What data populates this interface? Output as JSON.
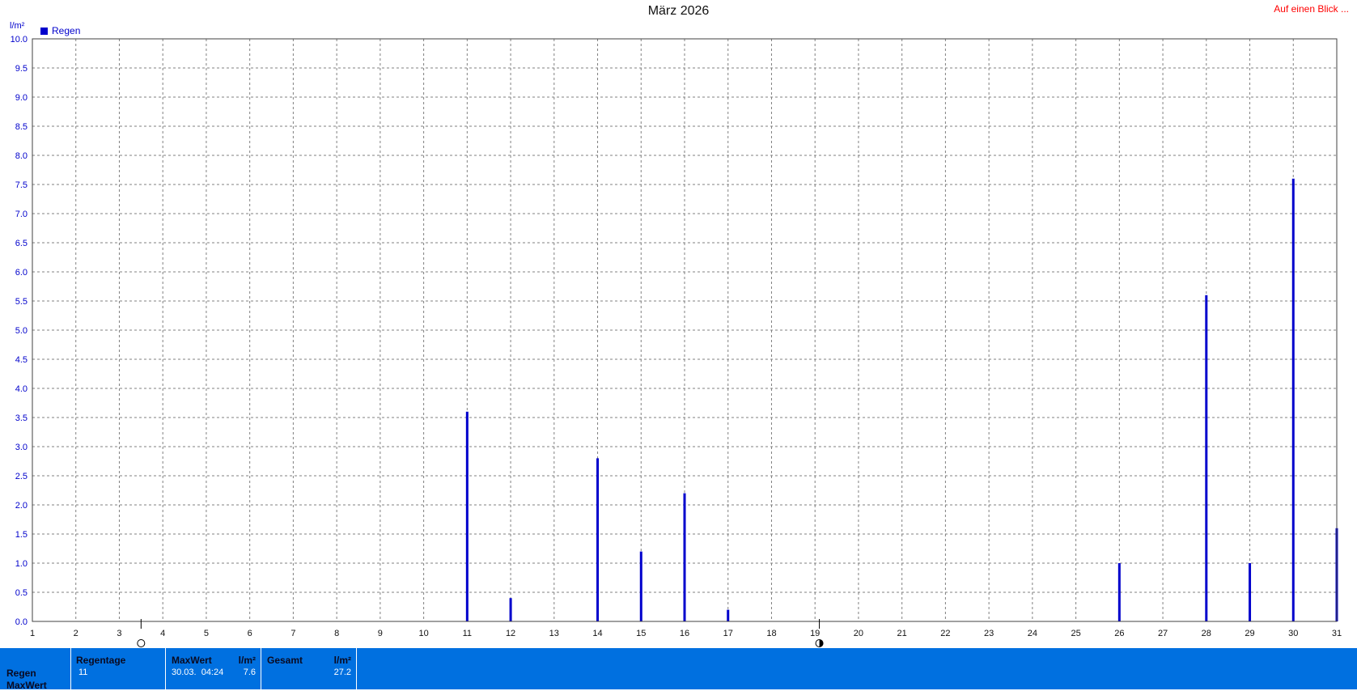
{
  "chart_data": {
    "type": "bar",
    "title": "März 2026",
    "ylabel": "l/m²",
    "ylim": [
      0,
      10
    ],
    "yticks": [
      "0.0",
      "0.5",
      "1.0",
      "1.5",
      "2.0",
      "2.5",
      "3.0",
      "3.5",
      "4.0",
      "4.5",
      "5.0",
      "5.5",
      "6.0",
      "6.5",
      "7.0",
      "7.5",
      "8.0",
      "8.5",
      "9.0",
      "9.5",
      "10.0"
    ],
    "xlim": [
      1,
      31
    ],
    "xticks": [
      "1",
      "2",
      "3",
      "4",
      "5",
      "6",
      "7",
      "8",
      "9",
      "10",
      "11",
      "12",
      "13",
      "14",
      "15",
      "16",
      "17",
      "18",
      "19",
      "20",
      "21",
      "22",
      "23",
      "24",
      "25",
      "26",
      "27",
      "28",
      "29",
      "30",
      "31"
    ],
    "grid": true,
    "legend": "top-left",
    "series": [
      {
        "name": "Regen",
        "color": "#0000cc",
        "x": [
          11,
          12,
          14,
          15,
          16,
          17,
          26,
          28,
          29,
          30,
          31
        ],
        "values": [
          3.6,
          0.4,
          2.8,
          1.2,
          2.2,
          0.2,
          1.0,
          5.6,
          1.0,
          7.6,
          1.6
        ]
      }
    ],
    "moon_phases": [
      {
        "day": 3.5,
        "phase": "full-moon-icon"
      },
      {
        "day": 19.1,
        "phase": "last-quarter-moon-icon"
      }
    ]
  },
  "header": {
    "link_label": "Auf einen Blick ..."
  },
  "footer": {
    "row_labels": [
      "Regen",
      "MaxWert"
    ],
    "regentage": {
      "label": "Regentage",
      "value": "11"
    },
    "maxwert": {
      "label": "MaxWert",
      "unit": "l/m²",
      "date": "30.03.  04:24",
      "value": "7.6"
    },
    "gesamt": {
      "label": "Gesamt",
      "unit": "l/m²",
      "value": "27.2"
    }
  },
  "colors": {
    "series": "#0000cc",
    "footer_bg": "#0070e0",
    "link": "#ff0000",
    "grid": "#808080"
  }
}
